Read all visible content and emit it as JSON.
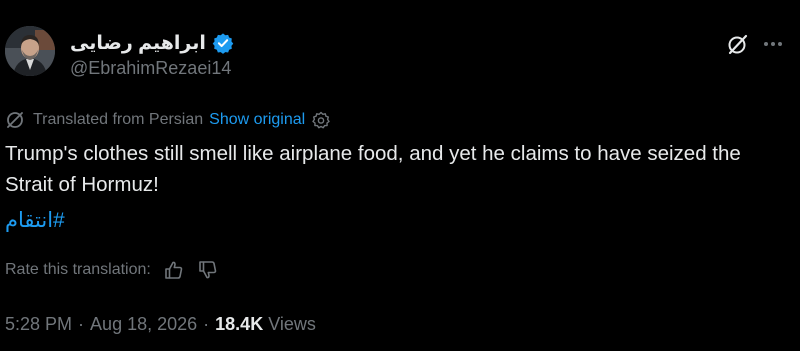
{
  "tweet": {
    "author": {
      "display_name": "ابراهیم رضایی",
      "handle": "@EbrahimRezaei14",
      "verified_icon": "verified-badge-icon",
      "avatar_icon": "avatar"
    },
    "header_actions": {
      "grok_icon": "grok-icon",
      "more_icon": "more-options-icon"
    },
    "translation": {
      "label": "Translated from Persian",
      "show_original": "Show original",
      "settings_icon": "settings-icon"
    },
    "text": "Trump's clothes still smell like airplane food, and yet he claims to have seized the Strait of Hormuz!",
    "hashtag": "#انتقام",
    "rate": {
      "label": "Rate this translation:",
      "up_icon": "thumbs-up-icon",
      "down_icon": "thumbs-down-icon"
    },
    "meta": {
      "time": "5:28 PM",
      "separator": "·",
      "date": "Aug 18, 2026",
      "views_count": "18.4K",
      "views_label": "Views"
    }
  },
  "colors": {
    "background": "#000000",
    "primary_text": "#e7e9ea",
    "secondary_text": "#71767b",
    "link": "#1d9bf0",
    "verified": "#1d9bf0"
  }
}
